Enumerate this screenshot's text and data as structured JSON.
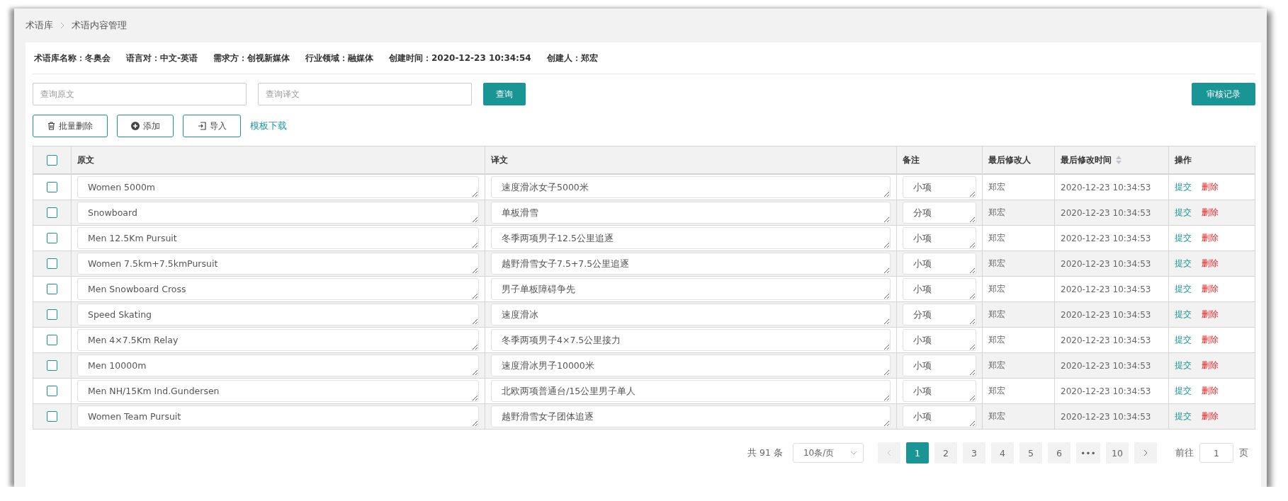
{
  "breadcrumb": [
    "术语库",
    "术语内容管理"
  ],
  "info": [
    {
      "label": "术语库名称：",
      "value": "冬奥会"
    },
    {
      "label": "语言对：",
      "value": "中文-英语"
    },
    {
      "label": "需求方：",
      "value": "创视新媒体"
    },
    {
      "label": "行业领域：",
      "value": "融媒体"
    },
    {
      "label": "创建时间：",
      "value": "2020-12-23 10:34:54"
    },
    {
      "label": "创建人：",
      "value": "郑宏"
    }
  ],
  "search": {
    "source_placeholder": "查询原文",
    "target_placeholder": "查询译文",
    "button": "查询",
    "audit_button": "审核记录"
  },
  "actions": [
    {
      "kind": "delete",
      "label": "批量删除"
    },
    {
      "kind": "add",
      "label": "添加"
    },
    {
      "kind": "import",
      "label": "导入"
    }
  ],
  "template_link": "模板下载",
  "table": {
    "header_checked": false,
    "columns": [
      "原文",
      "译文",
      "备注",
      "最后修改人",
      "最后修改时间",
      "操作"
    ],
    "rows": [
      {
        "checked": false,
        "source": "Women 5000m",
        "target": "速度滑冰女子5000米",
        "note": "小项",
        "editor": "郑宏",
        "time": "2020-12-23 10:34:53",
        "submit": "提交",
        "delete": "删除"
      },
      {
        "checked": false,
        "source": "Snowboard",
        "target": "单板滑雪",
        "note": "分项",
        "editor": "郑宏",
        "time": "2020-12-23 10:34:53",
        "submit": "提交",
        "delete": "删除"
      },
      {
        "checked": false,
        "source": "Men 12.5Km Pursuit",
        "target": "冬季两项男子12.5公里追逐",
        "note": "小项",
        "editor": "郑宏",
        "time": "2020-12-23 10:34:53",
        "submit": "提交",
        "delete": "删除"
      },
      {
        "checked": false,
        "source": "Women 7.5km+7.5kmPursuit",
        "target": "越野滑雪女子7.5+7.5公里追逐",
        "note": "小项",
        "editor": "郑宏",
        "time": "2020-12-23 10:34:53",
        "submit": "提交",
        "delete": "删除"
      },
      {
        "checked": false,
        "source": "Men Snowboard Cross",
        "target": "男子单板障碍争先",
        "note": "小项",
        "editor": "郑宏",
        "time": "2020-12-23 10:34:53",
        "submit": "提交",
        "delete": "删除"
      },
      {
        "checked": false,
        "source": "Speed Skating",
        "target": "速度滑冰",
        "note": "分项",
        "editor": "郑宏",
        "time": "2020-12-23 10:34:53",
        "submit": "提交",
        "delete": "删除"
      },
      {
        "checked": false,
        "source": "Men 4×7.5Km Relay",
        "target": "冬季两项男子4×7.5公里接力",
        "note": "小项",
        "editor": "郑宏",
        "time": "2020-12-23 10:34:53",
        "submit": "提交",
        "delete": "删除"
      },
      {
        "checked": false,
        "source": "Men 10000m",
        "target": "速度滑冰男子10000米",
        "note": "小项",
        "editor": "郑宏",
        "time": "2020-12-23 10:34:53",
        "submit": "提交",
        "delete": "删除"
      },
      {
        "checked": false,
        "source": "Men NH/15Km Ind.Gundersen",
        "target": "北欧两项普通台/15公里男子单人",
        "note": "小项",
        "editor": "郑宏",
        "time": "2020-12-23 10:34:53",
        "submit": "提交",
        "delete": "删除"
      },
      {
        "checked": false,
        "source": "Women Team Pursuit",
        "target": "越野滑雪女子团体追逐",
        "note": "小项",
        "editor": "郑宏",
        "time": "2020-12-23 10:34:53",
        "submit": "提交",
        "delete": "删除"
      }
    ]
  },
  "pagination": {
    "total": "共 91 条",
    "page_size": "10条/页",
    "pages": [
      {
        "label": "1",
        "selected": true
      },
      {
        "label": "2",
        "selected": false
      },
      {
        "label": "3",
        "selected": false
      },
      {
        "label": "4",
        "selected": false
      },
      {
        "label": "5",
        "selected": false
      },
      {
        "label": "6",
        "selected": false
      },
      {
        "label": "•••",
        "selected": false
      },
      {
        "label": "10",
        "selected": false
      }
    ],
    "goto_label": "前往",
    "goto_value": "1",
    "goto_suffix": "页"
  }
}
